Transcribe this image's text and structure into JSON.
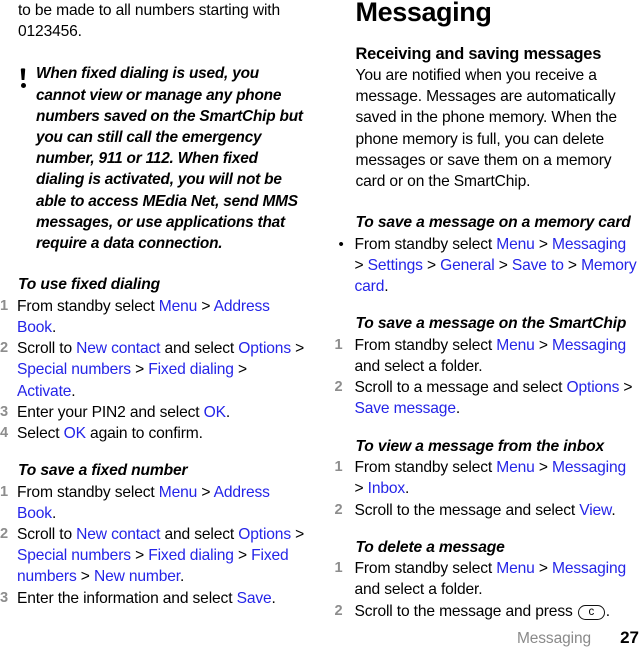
{
  "document": {
    "type": "phone-user-guide-page",
    "page_number": "27",
    "footer_section_label": "Messaging",
    "link_color": "#2424e8",
    "number_color": "#8d8d8d"
  },
  "left_column": {
    "continued_paragraph": "to be made to all numbers starting with 0123456.",
    "note": {
      "icon": "exclamation-note-icon",
      "text": "When fixed dialing is used, you cannot view or manage any phone numbers saved on the SmartChip but you can still call the emergency number, 911 or 112. When fixed dialing is activated, you will not be able to access MEdia Net, send MMS messages, or use applications that require a data connection."
    },
    "procedures": [
      {
        "heading": "To use fixed dialing",
        "list_type": "ordered",
        "steps": [
          {
            "marker": "1",
            "parts": [
              {
                "t": "From standby select ",
                "link": false
              },
              {
                "t": "Menu",
                "link": true
              },
              {
                "t": " > ",
                "link": false
              },
              {
                "t": "Address Book",
                "link": true
              },
              {
                "t": ".",
                "link": false
              }
            ]
          },
          {
            "marker": "2",
            "parts": [
              {
                "t": "Scroll to ",
                "link": false
              },
              {
                "t": "New contact",
                "link": true
              },
              {
                "t": " and select ",
                "link": false
              },
              {
                "t": "Options",
                "link": true
              },
              {
                "t": " > ",
                "link": false
              },
              {
                "t": "Special numbers",
                "link": true
              },
              {
                "t": " > ",
                "link": false
              },
              {
                "t": "Fixed dialing",
                "link": true
              },
              {
                "t": " > ",
                "link": false
              },
              {
                "t": "Activate",
                "link": true
              },
              {
                "t": ".",
                "link": false
              }
            ]
          },
          {
            "marker": "3",
            "parts": [
              {
                "t": "Enter your PIN2 and select ",
                "link": false
              },
              {
                "t": "OK",
                "link": true
              },
              {
                "t": ".",
                "link": false
              }
            ]
          },
          {
            "marker": "4",
            "parts": [
              {
                "t": "Select ",
                "link": false
              },
              {
                "t": "OK",
                "link": true
              },
              {
                "t": " again to confirm.",
                "link": false
              }
            ]
          }
        ]
      },
      {
        "heading": "To save a fixed number",
        "list_type": "ordered",
        "steps": [
          {
            "marker": "1",
            "parts": [
              {
                "t": "From standby select ",
                "link": false
              },
              {
                "t": "Menu",
                "link": true
              },
              {
                "t": " > ",
                "link": false
              },
              {
                "t": "Address Book",
                "link": true
              },
              {
                "t": ".",
                "link": false
              }
            ]
          },
          {
            "marker": "2",
            "parts": [
              {
                "t": "Scroll to ",
                "link": false
              },
              {
                "t": "New contact",
                "link": true
              },
              {
                "t": " and select ",
                "link": false
              },
              {
                "t": "Options",
                "link": true
              },
              {
                "t": " > ",
                "link": false
              },
              {
                "t": "Special numbers",
                "link": true
              },
              {
                "t": " > ",
                "link": false
              },
              {
                "t": "Fixed dialing",
                "link": true
              },
              {
                "t": " > ",
                "link": false
              },
              {
                "t": "Fixed numbers",
                "link": true
              },
              {
                "t": " > ",
                "link": false
              },
              {
                "t": "New number",
                "link": true
              },
              {
                "t": ".",
                "link": false
              }
            ]
          },
          {
            "marker": "3",
            "parts": [
              {
                "t": "Enter the information and select ",
                "link": false
              },
              {
                "t": "Save",
                "link": true
              },
              {
                "t": ".",
                "link": false
              }
            ]
          }
        ]
      }
    ]
  },
  "right_column": {
    "chapter_title": "Messaging",
    "section_heading": "Receiving and saving messages",
    "section_paragraph": "You are notified when you receive a message. Messages are automatically saved in the phone memory. When the phone memory is full, you can delete messages or save them on a memory card or on the SmartChip.",
    "procedures": [
      {
        "heading": "To save a message on a memory card",
        "list_type": "bulleted",
        "steps": [
          {
            "marker": "•",
            "parts": [
              {
                "t": "From standby select ",
                "link": false
              },
              {
                "t": "Menu",
                "link": true
              },
              {
                "t": " > ",
                "link": false
              },
              {
                "t": "Messaging",
                "link": true
              },
              {
                "t": " > ",
                "link": false
              },
              {
                "t": "Settings",
                "link": true
              },
              {
                "t": " > ",
                "link": false
              },
              {
                "t": "General",
                "link": true
              },
              {
                "t": " > ",
                "link": false
              },
              {
                "t": "Save to",
                "link": true
              },
              {
                "t": " > ",
                "link": false
              },
              {
                "t": "Memory card",
                "link": true
              },
              {
                "t": ".",
                "link": false
              }
            ]
          }
        ]
      },
      {
        "heading": "To save a message on the SmartChip",
        "list_type": "ordered",
        "steps": [
          {
            "marker": "1",
            "parts": [
              {
                "t": "From standby select ",
                "link": false
              },
              {
                "t": "Menu",
                "link": true
              },
              {
                "t": " > ",
                "link": false
              },
              {
                "t": "Messaging",
                "link": true
              },
              {
                "t": " and select a folder.",
                "link": false
              }
            ]
          },
          {
            "marker": "2",
            "parts": [
              {
                "t": "Scroll to a message and select ",
                "link": false
              },
              {
                "t": "Options",
                "link": true
              },
              {
                "t": " > ",
                "link": false
              },
              {
                "t": "Save message",
                "link": true
              },
              {
                "t": ".",
                "link": false
              }
            ]
          }
        ]
      },
      {
        "heading": "To view a message from the inbox",
        "list_type": "ordered",
        "steps": [
          {
            "marker": "1",
            "parts": [
              {
                "t": "From standby select ",
                "link": false
              },
              {
                "t": "Menu",
                "link": true
              },
              {
                "t": " > ",
                "link": false
              },
              {
                "t": "Messaging",
                "link": true
              },
              {
                "t": " > ",
                "link": false
              },
              {
                "t": "Inbox",
                "link": true
              },
              {
                "t": ".",
                "link": false
              }
            ]
          },
          {
            "marker": "2",
            "parts": [
              {
                "t": "Scroll to the message and select ",
                "link": false
              },
              {
                "t": "View",
                "link": true
              },
              {
                "t": ".",
                "link": false
              }
            ]
          }
        ]
      },
      {
        "heading": "To delete a message",
        "list_type": "ordered",
        "steps": [
          {
            "marker": "1",
            "parts": [
              {
                "t": "From standby select ",
                "link": false
              },
              {
                "t": "Menu",
                "link": true
              },
              {
                "t": " > ",
                "link": false
              },
              {
                "t": "Messaging",
                "link": true
              },
              {
                "t": " and select a folder.",
                "link": false
              }
            ]
          },
          {
            "marker": "2",
            "parts": [
              {
                "t": "Scroll to the message and press ",
                "link": false
              },
              {
                "t": "c",
                "link": false,
                "key": true
              },
              {
                "t": ".",
                "link": false
              }
            ]
          }
        ]
      }
    ]
  }
}
